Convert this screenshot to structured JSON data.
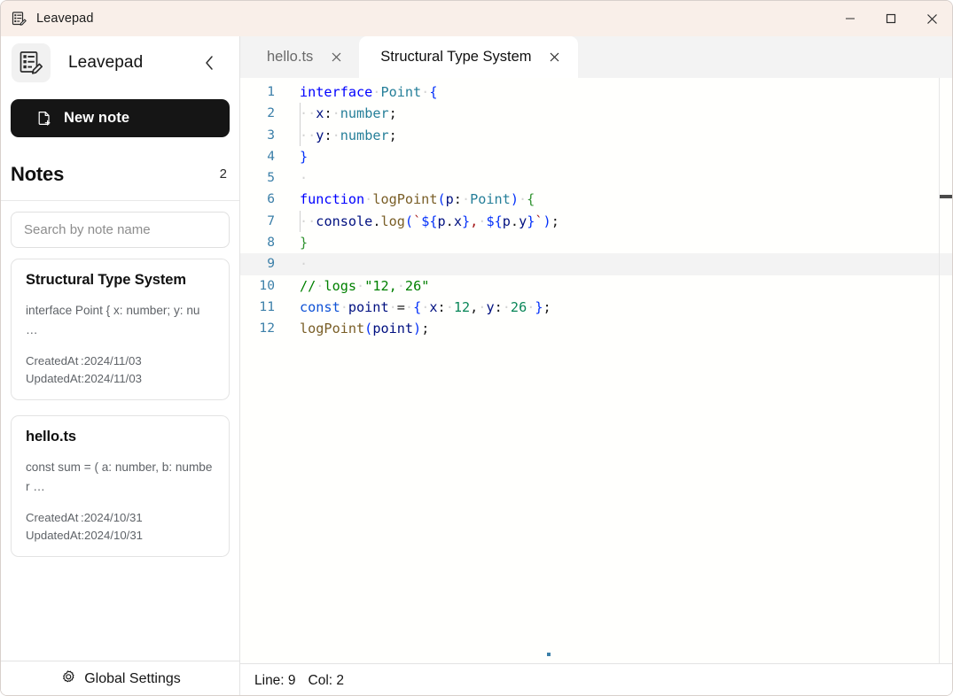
{
  "window": {
    "app_icon": "leavepad-icon",
    "title": "Leavepad",
    "controls": {
      "minimize": "minimize-icon",
      "maximize": "maximize-icon",
      "close": "close-icon"
    }
  },
  "sidebar": {
    "brand": {
      "logo": "leavepad-logo-icon",
      "name": "Leavepad",
      "collapse_icon": "chevron-left-icon"
    },
    "new_note": {
      "label": "New note",
      "icon": "file-plus-icon"
    },
    "notes_header": {
      "title": "Notes",
      "count": "2"
    },
    "search": {
      "placeholder": "Search by note name",
      "value": ""
    },
    "notes": [
      {
        "title": "Structural Type System",
        "excerpt": "interface Point { x: number; y: nu …",
        "created_label": "CreatedAt :",
        "created": "2024/11/03",
        "updated_label": "UpdatedAt:",
        "updated": "2024/11/03"
      },
      {
        "title": "hello.ts",
        "excerpt": "const sum = ( a: number, b: number …",
        "created_label": "CreatedAt :",
        "created": "2024/10/31",
        "updated_label": "UpdatedAt:",
        "updated": "2024/10/31"
      }
    ],
    "global_settings": {
      "label": "Global Settings",
      "icon": "gear-icon"
    }
  },
  "editor": {
    "tabs": [
      {
        "label": "hello.ts",
        "active": false,
        "close_icon": "close-icon"
      },
      {
        "label": "Structural Type System",
        "active": true,
        "close_icon": "close-icon"
      }
    ],
    "lines": [
      {
        "n": "1",
        "text": "interface Point {"
      },
      {
        "n": "2",
        "text": "  x: number;"
      },
      {
        "n": "3",
        "text": "  y: number;"
      },
      {
        "n": "4",
        "text": "}"
      },
      {
        "n": "5",
        "text": " "
      },
      {
        "n": "6",
        "text": "function logPoint(p: Point) {"
      },
      {
        "n": "7",
        "text": "  console.log(`${p.x}, ${p.y}`);"
      },
      {
        "n": "8",
        "text": "}"
      },
      {
        "n": "9",
        "text": " "
      },
      {
        "n": "10",
        "text": "// logs \"12, 26\""
      },
      {
        "n": "11",
        "text": "const point = { x: 12, y: 26 };"
      },
      {
        "n": "12",
        "text": "logPoint(point);"
      }
    ],
    "current_line": "9",
    "status": {
      "line_label": "Line: 9",
      "col_label": "Col: 2"
    }
  },
  "colors": {
    "titlebar_bg": "#f9efe9",
    "tabbar_bg": "#f3f3f3",
    "editor_bg": "#fffffd",
    "accent_dark": "#151515",
    "keyword": "#0000ff",
    "type": "#267f99",
    "function": "#795e26",
    "number": "#098658",
    "string": "#a31515",
    "comment": "#008000",
    "gutter": "#3b7fa8"
  }
}
